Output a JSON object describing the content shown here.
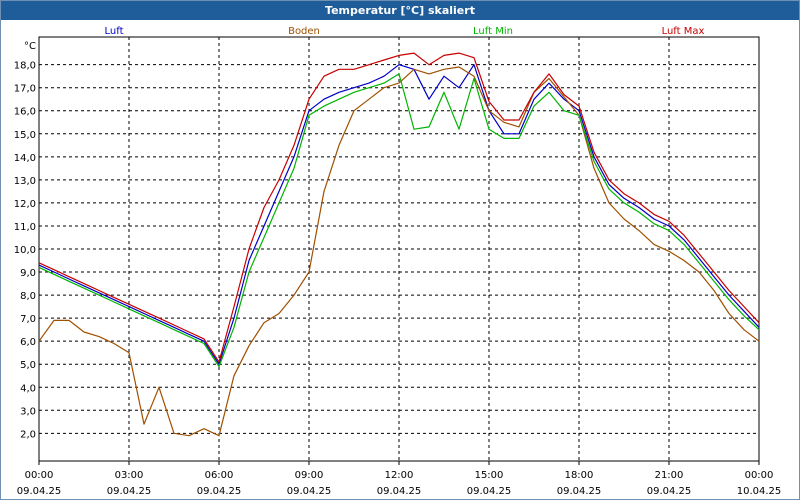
{
  "window": {
    "title": "Temperatur [°C] skaliert"
  },
  "chart_data": {
    "type": "line",
    "unit_label": "°C",
    "grid": true,
    "legend_placement": "top",
    "ylim": [
      0.8,
      19.2
    ],
    "xlim": [
      "09.04.25 00:00",
      "10.04.25 00:00"
    ],
    "y_ticks": [
      "2,0",
      "3,0",
      "4,0",
      "5,0",
      "6,0",
      "7,0",
      "8,0",
      "9,0",
      "10,0",
      "11,0",
      "12,0",
      "13,0",
      "14,0",
      "15,0",
      "16,0",
      "17,0",
      "18,0"
    ],
    "x_ticks": [
      {
        "time": "00:00",
        "date": "09.04.25",
        "hour": 0
      },
      {
        "time": "03:00",
        "date": "09.04.25",
        "hour": 3
      },
      {
        "time": "06:00",
        "date": "09.04.25",
        "hour": 6
      },
      {
        "time": "09:00",
        "date": "09.04.25",
        "hour": 9
      },
      {
        "time": "12:00",
        "date": "09.04.25",
        "hour": 12
      },
      {
        "time": "15:00",
        "date": "09.04.25",
        "hour": 15
      },
      {
        "time": "18:00",
        "date": "09.04.25",
        "hour": 18
      },
      {
        "time": "21:00",
        "date": "09.04.25",
        "hour": 21
      },
      {
        "time": "00:00",
        "date": "10.04.25",
        "hour": 24
      }
    ],
    "x_hours": [
      0,
      0.5,
      1,
      1.5,
      2,
      2.5,
      3,
      3.5,
      4,
      4.5,
      5,
      5.5,
      6,
      6.5,
      7,
      7.5,
      8,
      8.5,
      9,
      9.5,
      10,
      10.5,
      11,
      11.5,
      12,
      12.5,
      13,
      13.5,
      14,
      14.5,
      15,
      15.5,
      16,
      16.5,
      17,
      17.5,
      18,
      18.5,
      19,
      19.5,
      20,
      20.5,
      21,
      21.5,
      22,
      22.5,
      23,
      23.5,
      24
    ],
    "series": [
      {
        "name": "Luft",
        "color": "#0000c8",
        "values": [
          9.3,
          9.0,
          8.7,
          8.4,
          8.1,
          7.8,
          7.5,
          7.2,
          6.9,
          6.6,
          6.3,
          6.0,
          5.0,
          7.0,
          9.5,
          11.0,
          12.5,
          14.0,
          16.0,
          16.5,
          16.8,
          17.0,
          17.2,
          17.5,
          18.0,
          17.8,
          16.5,
          17.5,
          17.0,
          18.0,
          16.0,
          15.0,
          15.0,
          16.5,
          17.2,
          16.5,
          16.0,
          14.0,
          12.8,
          12.2,
          11.8,
          11.3,
          11.0,
          10.4,
          9.6,
          8.8,
          8.0,
          7.3,
          6.6
        ]
      },
      {
        "name": "Boden",
        "color": "#a05000",
        "values": [
          6.0,
          6.9,
          6.9,
          6.4,
          6.2,
          5.9,
          5.5,
          2.4,
          4.0,
          2.0,
          1.9,
          2.2,
          1.9,
          4.5,
          5.8,
          6.8,
          7.2,
          8.0,
          9.0,
          12.5,
          14.5,
          16.0,
          16.5,
          17.0,
          17.2,
          17.8,
          17.6,
          17.8,
          17.9,
          17.5,
          16.0,
          15.5,
          15.3,
          16.8,
          17.4,
          16.6,
          15.8,
          13.5,
          12.0,
          11.3,
          10.8,
          10.2,
          9.9,
          9.5,
          9.0,
          8.2,
          7.2,
          6.5,
          6.0
        ]
      },
      {
        "name": "Luft Min",
        "color": "#00b400",
        "values": [
          9.2,
          8.9,
          8.6,
          8.3,
          8.0,
          7.7,
          7.4,
          7.1,
          6.8,
          6.5,
          6.2,
          5.9,
          4.9,
          6.6,
          9.0,
          10.5,
          12.0,
          13.5,
          15.8,
          16.2,
          16.5,
          16.8,
          17.0,
          17.2,
          17.6,
          15.2,
          15.3,
          16.8,
          15.2,
          17.4,
          15.2,
          14.8,
          14.8,
          16.2,
          16.8,
          16.0,
          15.8,
          13.8,
          12.6,
          12.0,
          11.6,
          11.1,
          10.8,
          10.2,
          9.4,
          8.6,
          7.8,
          7.1,
          6.5
        ]
      },
      {
        "name": "Luft Max",
        "color": "#c80000",
        "values": [
          9.4,
          9.1,
          8.8,
          8.5,
          8.2,
          7.9,
          7.6,
          7.3,
          7.0,
          6.7,
          6.4,
          6.1,
          5.1,
          7.5,
          10.0,
          11.8,
          13.0,
          14.5,
          16.5,
          17.5,
          17.8,
          17.8,
          18.0,
          18.2,
          18.4,
          18.5,
          18.0,
          18.4,
          18.5,
          18.3,
          16.4,
          15.6,
          15.6,
          16.8,
          17.6,
          16.7,
          16.2,
          14.2,
          13.0,
          12.4,
          12.0,
          11.5,
          11.2,
          10.6,
          9.8,
          9.0,
          8.2,
          7.5,
          6.8
        ]
      }
    ]
  }
}
